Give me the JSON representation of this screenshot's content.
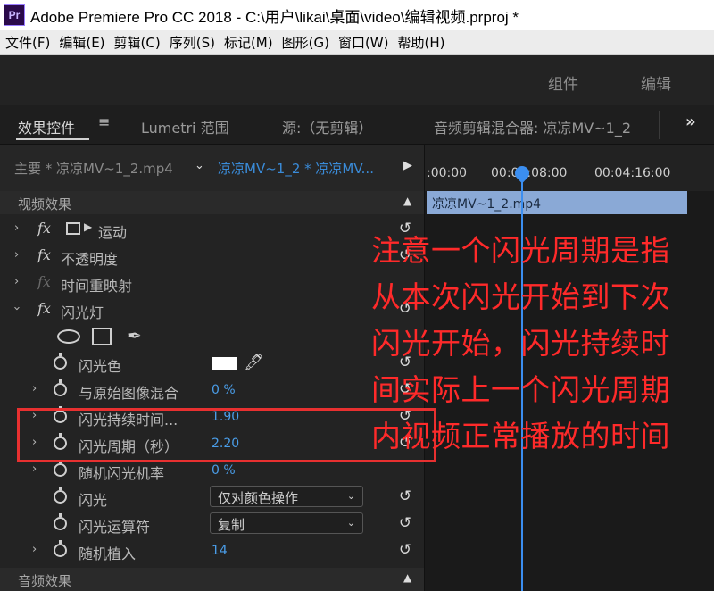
{
  "window": {
    "app_icon": "Pr",
    "title": "Adobe Premiere Pro CC 2018 - C:\\用户\\likai\\桌面\\video\\编辑视频.prproj *"
  },
  "menu": [
    "文件(F)",
    "编辑(E)",
    "剪辑(C)",
    "序列(S)",
    "标记(M)",
    "图形(G)",
    "窗口(W)",
    "帮助(H)"
  ],
  "workspaces": [
    "组件",
    "编辑"
  ],
  "panel_tabs": {
    "effect_controls": "效果控件",
    "menu_glyph": "≡",
    "lumetri": "Lumetri 范围",
    "source": "源:（无剪辑）",
    "audio_mixer": "音频剪辑混合器: 凉凉MV~1_2",
    "more": "»"
  },
  "clip_header": {
    "master": "主要 * 凉凉MV~1_2.mp4",
    "sequence": "凉凉MV~1_2 * 凉凉MV..."
  },
  "sections": {
    "video_effects": "视频效果",
    "audio_effects": "音频效果"
  },
  "effects": {
    "motion": "运动",
    "opacity": "不透明度",
    "time_remap": "时间重映射",
    "strobe": "闪光灯"
  },
  "params": {
    "flash_color": "闪光色",
    "blend": "与原始图像混合",
    "blend_value": "0 %",
    "duration": "闪光持续时间...",
    "duration_value": "1.90",
    "period": "闪光周期（秒）",
    "period_value": "2.20",
    "random_prob": "随机闪光机率",
    "random_prob_value": "0 %",
    "flash": "闪光",
    "flash_option": "仅对颜色操作",
    "operator": "闪光运算符",
    "operator_option": "复制",
    "random_seed": "随机植入",
    "random_seed_value": "14"
  },
  "timeline": {
    "ticks": [
      ":00:00",
      "00:00:08:00",
      "00:04:16:00"
    ],
    "clip_name": "凉凉MV~1_2.mp4"
  },
  "annotation": {
    "lines": [
      "注意一个闪光周期是指",
      "从本次闪光开始到下次",
      "闪光开始，闪光持续时",
      "间实际上一个闪光周期",
      "内视频正常播放的时间"
    ]
  },
  "colors": {
    "accent_blue": "#3b8ef0",
    "annotation_red": "#ff2a2a",
    "clip_blue": "#8aa9d6"
  }
}
